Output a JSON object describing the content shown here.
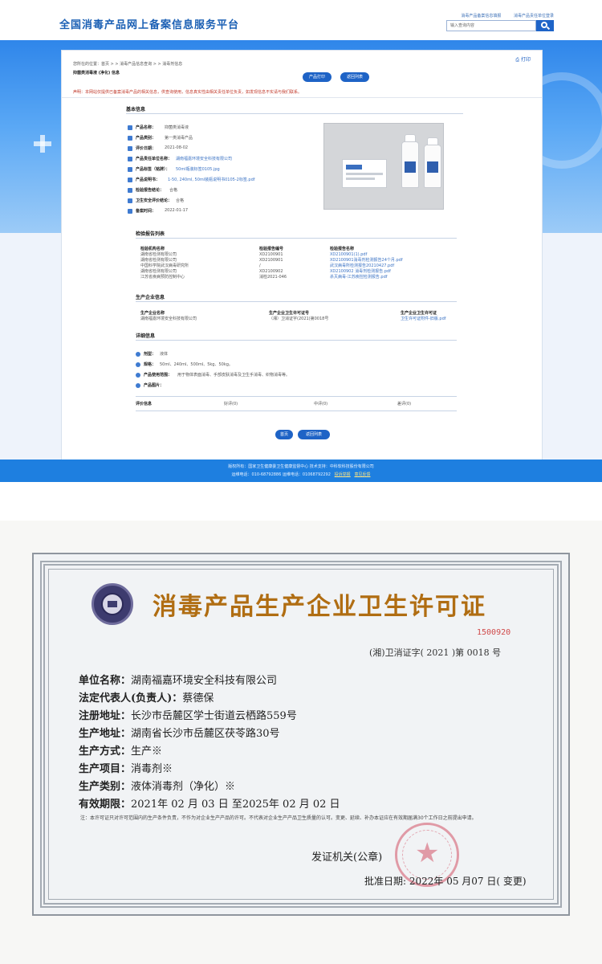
{
  "web": {
    "site_title": "全国消毒产品网上备案信息服务平台",
    "top_links": [
      "消毒产品备案信息填报",
      "消毒产品责任单位登录"
    ],
    "search_placeholder": "输入查询内容",
    "breadcrumb": "您所在的位置：首页 > > 消毒产品信息查询 > > 消毒剂信息",
    "record_label": "抑菌类消毒液 (净化) 信息",
    "print_icon_label": "打印",
    "buttons": {
      "print": "产品打印",
      "back": "返回列表",
      "home": "首页",
      "back_bottom": "返回列表"
    },
    "notice": "声明：本网站仅提供已备案消毒产品的相关信息，供查询使用，信息真实性由相关责任单位负责，如发现信息不实请与我们联系。",
    "basic_info": {
      "title": "基本信息",
      "rows": [
        {
          "label": "产品名称：",
          "value": "抑菌类消毒液"
        },
        {
          "label": "产品类别：",
          "value": "第一类消毒产品"
        },
        {
          "label": "评价日期：",
          "value": "2021-08-02"
        },
        {
          "label": "产品责任单位名称：",
          "value": "湖南福嘉环境安全科技有限公司",
          "link": true
        },
        {
          "label": "产品标签（铭牌）：",
          "value": "50ml瓶装标签0105.jpg",
          "link": true
        },
        {
          "label": "产品说明书：",
          "value": "1-50, 240ml, 50ml装瓶说明书0105-2标签.pdf",
          "link": true
        },
        {
          "label": "检验报告结论：",
          "value": "合格"
        },
        {
          "label": "卫生安全评价结论：",
          "value": "合格"
        },
        {
          "label": "备案时间：",
          "value": "2022-01-17"
        }
      ]
    },
    "inspection": {
      "title": "检验报告列表",
      "headers": [
        "检验机构名称",
        "检验报告编号",
        "检验报告名称"
      ],
      "rows": [
        [
          "湖南省检测有限公司",
          "XD2100901",
          "XD2100901(1).pdf"
        ],
        [
          "湖南省检测有限公司",
          "XD2100901",
          "XD2100901消毒剂检测报告24个月.pdf"
        ],
        [
          "中国科学院武汉病毒研究所",
          "/",
          "武汉病毒所检测报告20210427.pdf"
        ],
        [
          "湖南省检测有限公司",
          "XD2100902",
          "XD2100902 消毒剂检测报告.pdf"
        ],
        [
          "江苏省疾病预防控制中心",
          "消检2021-046",
          "杀灭病毒-江苏疾控检测报告.pdf"
        ]
      ]
    },
    "manufacturer": {
      "title": "生产企业信息",
      "headers": [
        "生产企业名称",
        "生产企业卫生许可证号",
        "生产企业卫生许可证"
      ],
      "rows": [
        [
          "湖南福嘉环境安全科技有限公司",
          "（湘）卫消证字(2021)第0018号",
          "卫生许可证附件-旧版.pdf"
        ]
      ]
    },
    "details": {
      "title": "详细信息",
      "rows": [
        {
          "label": "剂型：",
          "value": "液体"
        },
        {
          "label": "规格：",
          "value": "50ml、240ml、500ml、5kg、50kg。"
        },
        {
          "label": "产品使用范围：",
          "value": "用于物体表面消毒、手部皮肤消毒及卫生手消毒、织物消毒等。"
        },
        {
          "label": "产品图片：",
          "value": ""
        }
      ]
    },
    "evaluation": {
      "title": "评价信息",
      "good": "好评(0)",
      "medium": "中评(0)",
      "bad": "差评(0)"
    },
    "footer": {
      "line1": "版权所有：国家卫生健康委卫生健康监督中心  技术支持：中科软科技股份有限公司",
      "line2": "运维电话：010-68792886 运维电话：01068792292",
      "links": [
        "投诉举报",
        "意见反馈"
      ]
    }
  },
  "certificate": {
    "title": "消毒产品生产企业卫生许可证",
    "serial": "1500920",
    "license_no": "(湘)卫消证字( 2021 )第 0018   号",
    "fields": [
      {
        "key": "单位名称：",
        "value": "湖南福嘉环境安全科技有限公司"
      },
      {
        "key": "法定代表人(负责人)：",
        "value": "蔡德保"
      },
      {
        "key": "注册地址：",
        "value": "长沙市岳麓区学士街道云栖路559号"
      },
      {
        "key": "生产地址：",
        "value": "湖南省长沙市岳麓区茯苓路30号"
      },
      {
        "key": "生产方式：",
        "value": "生产※"
      },
      {
        "key": "生产项目：",
        "value": "消毒剂※"
      },
      {
        "key": "生产类别：",
        "value": "液体消毒剂（净化）※"
      },
      {
        "key": "有效期限：",
        "value": "2021年 02 月 03 日    至2025年  02 月 02 日"
      }
    ],
    "note": "注：本许可证只对许可范围内的生产条件负责，不作为对企业生产产品的许可。不代表对企业生产产品卫生质量的认可。变更、延续、补办本证应在有效期届满30个工作日之前提出申请。",
    "issuer": "发证机关(公章)",
    "approve_date": "批准日期: 2022年 05 月07 日( 变更)"
  },
  "colors": {
    "brand_blue": "#1e63c6",
    "title_gold": "#b06d12",
    "serial_red": "#d04a4a"
  }
}
